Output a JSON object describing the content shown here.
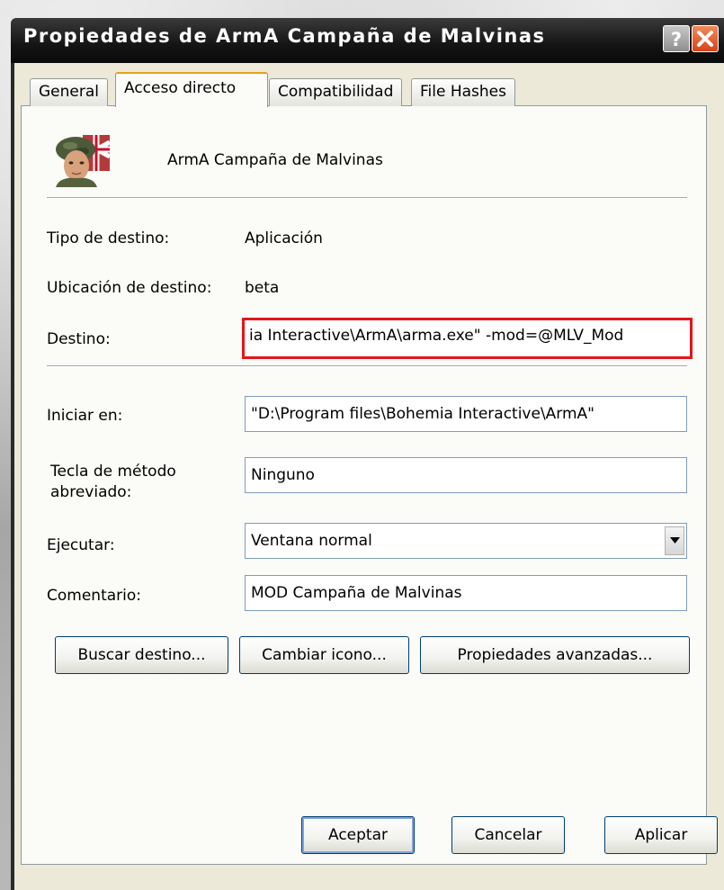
{
  "window": {
    "title": "Propiedades de ArmA Campaña de Malvinas",
    "help_glyph": "?"
  },
  "tabs": [
    {
      "label": "General",
      "active": false
    },
    {
      "label": "Acceso directo",
      "active": true
    },
    {
      "label": "Compatibilidad",
      "active": false
    },
    {
      "label": "File Hashes",
      "active": false
    }
  ],
  "shortcut": {
    "name": "ArmA Campaña de Malvinas",
    "icon": "soldier-portrait-icon"
  },
  "fields": {
    "target_type_label": "Tipo de destino:",
    "target_type_value": "Aplicación",
    "target_location_label": "Ubicación de destino:",
    "target_location_value": "beta",
    "target_label": "Destino:",
    "target_value": "ia Interactive\\ArmA\\arma.exe\" -mod=@MLV_Mod",
    "start_in_label": "Iniciar en:",
    "start_in_value": "\"D:\\Program files\\Bohemia Interactive\\ArmA\"",
    "hotkey_label_line1": "Tecla de método",
    "hotkey_label_line2": "abreviado:",
    "hotkey_value": "Ninguno",
    "run_label": "Ejecutar:",
    "run_value": "Ventana normal",
    "comment_label": "Comentario:",
    "comment_value": "MOD Campaña de Malvinas"
  },
  "buttons": {
    "find_target": "Buscar destino...",
    "change_icon": "Cambiar icono...",
    "advanced": "Propiedades avanzadas...",
    "ok": "Aceptar",
    "cancel": "Cancelar",
    "apply": "Aplicar"
  },
  "colors": {
    "highlight_border": "#e3151a",
    "title_bar": "#141414",
    "close_button": "#d9421a"
  }
}
